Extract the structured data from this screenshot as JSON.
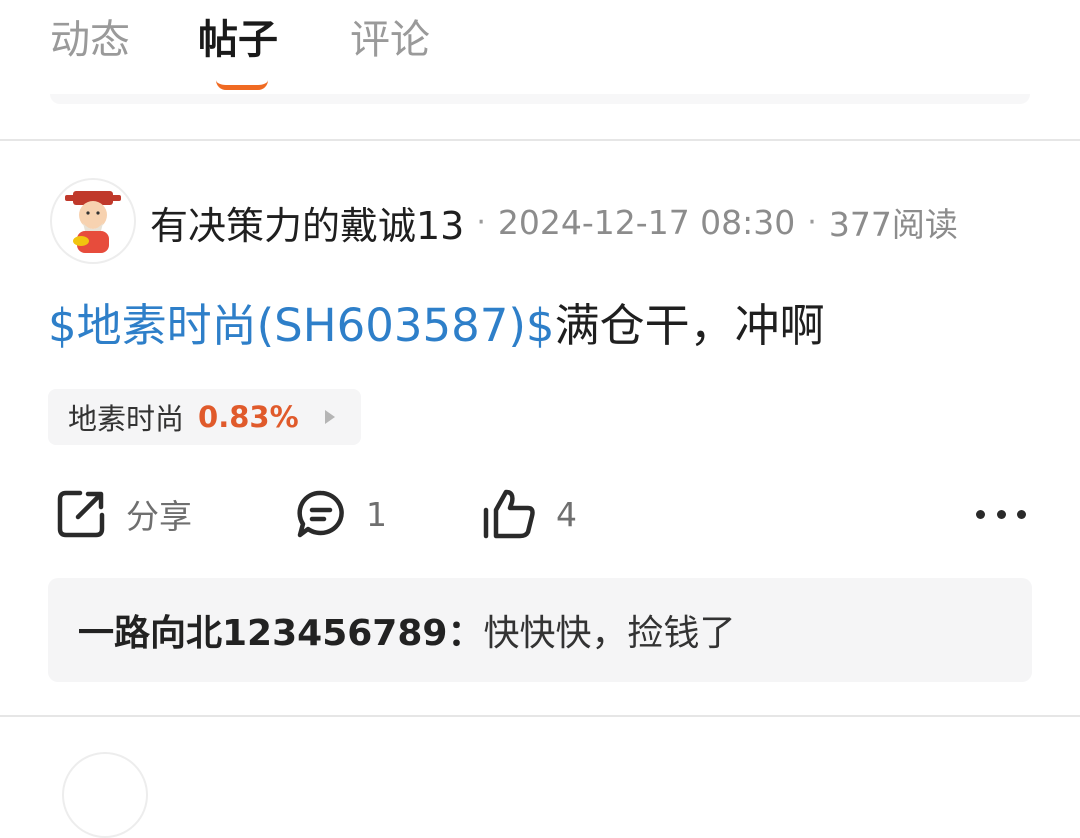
{
  "tabs": [
    {
      "label": "动态",
      "active": false
    },
    {
      "label": "帖子",
      "active": true
    },
    {
      "label": "评论",
      "active": false
    }
  ],
  "colors": {
    "accent": "#f06a22",
    "link": "#2e7fc9",
    "up": "#e05a2b"
  },
  "post": {
    "author": "有决策力的戴诚13",
    "datetime": "2024-12-17 08:30",
    "reads": "377阅读",
    "stock_link": "$地素时尚(SH603587)$",
    "text": "满仓干，冲啊",
    "stock_chip": {
      "name": "地素时尚",
      "change": "0.83%"
    },
    "actions": {
      "share_label": "分享",
      "comment_count": "1",
      "like_count": "4"
    }
  },
  "comment_preview": {
    "author": "一路向北123456789：",
    "text": "快快快，捡钱了"
  }
}
